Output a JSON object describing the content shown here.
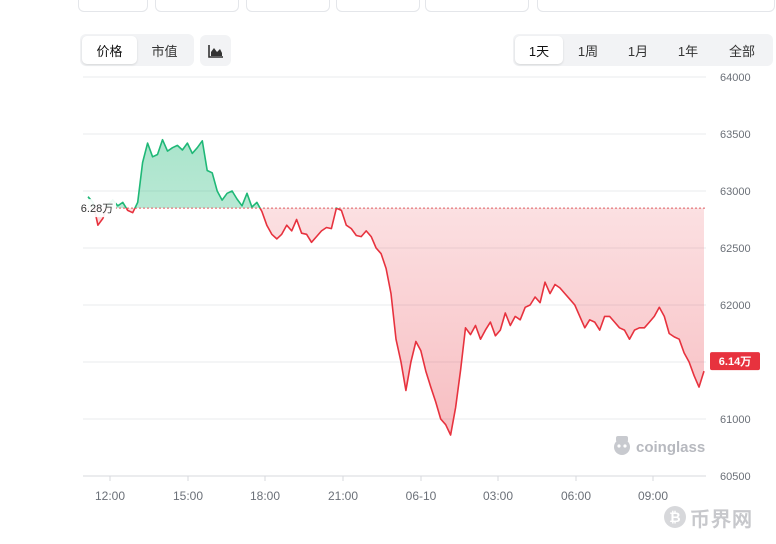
{
  "metric_tabs": [
    {
      "label": "价格",
      "active": true
    },
    {
      "label": "市值",
      "active": false
    }
  ],
  "range_tabs": [
    {
      "label": "1天",
      "active": true
    },
    {
      "label": "1周",
      "active": false
    },
    {
      "label": "1月",
      "active": false
    },
    {
      "label": "1年",
      "active": false
    },
    {
      "label": "全部",
      "active": false
    }
  ],
  "chart_icon": "area-chart-icon",
  "brand": {
    "logo_text": "coinglass",
    "watermark_text": "币界网"
  },
  "colors": {
    "up": "#1fb877",
    "down": "#e7323e",
    "baseline": "#e0595f",
    "grid": "#e9ebee",
    "axis_text": "#6b7078"
  },
  "chart_data": {
    "type": "area",
    "xlabel": "",
    "ylabel": "",
    "x_ticks": [
      "12:00",
      "15:00",
      "18:00",
      "21:00",
      "06-10",
      "03:00",
      "06:00",
      "09:00"
    ],
    "y_ticks": [
      64000,
      63500,
      63000,
      62500,
      62000,
      61500,
      61000,
      60500
    ],
    "ylim": [
      60500,
      64000
    ],
    "grid": true,
    "baseline_value": 62850,
    "baseline_label": "6.28万",
    "last_value_label": "6.14万",
    "series": [
      {
        "values": [
          62950,
          62900,
          62700,
          62760,
          62880,
          62920,
          62870,
          62900,
          62830,
          62810,
          62900,
          63250,
          63420,
          63300,
          63320,
          63450,
          63350,
          63380,
          63400,
          63360,
          63420,
          63330,
          63380,
          63440,
          63180,
          63160,
          63000,
          62920,
          62980,
          63000,
          62930,
          62870,
          62980,
          62860,
          62900,
          62820,
          62700,
          62620,
          62580,
          62620,
          62700,
          62650,
          62750,
          62630,
          62620,
          62550,
          62600,
          62650,
          62680,
          62670,
          62850,
          62830,
          62700,
          62670,
          62610,
          62600,
          62650,
          62600,
          62500,
          62450,
          62320,
          62100,
          61700,
          61500,
          61250,
          61500,
          61680,
          61600,
          61420,
          61280,
          61150,
          61000,
          60950,
          60860,
          61100,
          61430,
          61800,
          61740,
          61820,
          61700,
          61780,
          61850,
          61730,
          61780,
          61930,
          61820,
          61900,
          61870,
          61980,
          62000,
          62070,
          62020,
          62200,
          62100,
          62180,
          62150,
          62100,
          62050,
          62000,
          61900,
          61800,
          61870,
          61850,
          61780,
          61900,
          61900,
          61850,
          61800,
          61780,
          61700,
          61780,
          61800,
          61800,
          61850,
          61900,
          61980,
          61900,
          61750,
          61720,
          61700,
          61580,
          61500,
          61380,
          61280,
          61420
        ]
      }
    ]
  }
}
